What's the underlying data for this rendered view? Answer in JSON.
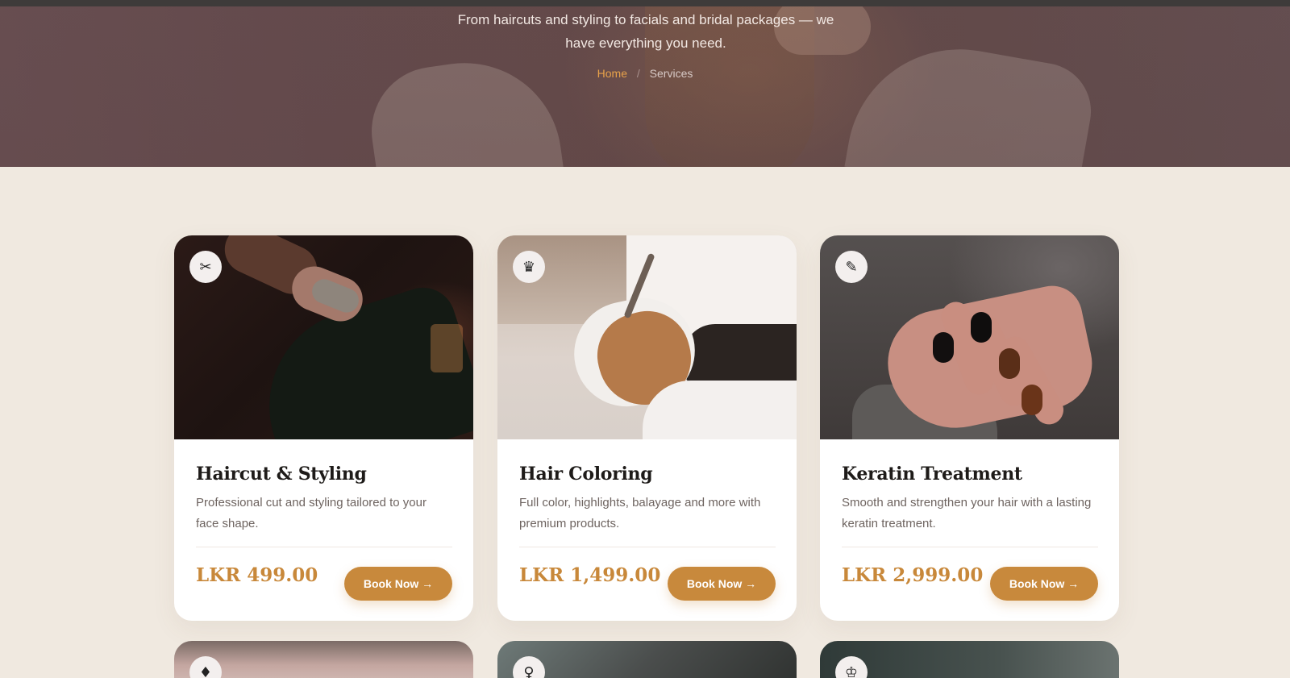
{
  "hero": {
    "subtitle": "From haircuts and styling to facials and bridal packages — we have everything you need.",
    "breadcrumb": {
      "home": "Home",
      "separator": "/",
      "current": "Services"
    }
  },
  "colors": {
    "accent": "#c8893c",
    "background": "#f0e9e0",
    "breadcrumb_active": "#e8a24a"
  },
  "services": [
    {
      "icon": "✂",
      "icon_name": "scissors-icon",
      "title": "Haircut & Styling",
      "description": "Professional cut and styling tailored to your face shape.",
      "price": "LKR 499.00",
      "button": "Book Now →"
    },
    {
      "icon": "♛",
      "icon_name": "woman-hair-icon",
      "title": "Hair Coloring",
      "description": "Full color, highlights, balayage and more with premium products.",
      "price": "LKR 1,499.00",
      "button": "Book Now →"
    },
    {
      "icon": "✎",
      "icon_name": "nail-polish-icon",
      "title": "Keratin Treatment",
      "description": "Smooth and strengthen your hair with a lasting keratin treatment.",
      "price": "LKR 2,999.00",
      "button": "Book Now →"
    }
  ],
  "next_row_icons": [
    {
      "icon": "♦",
      "icon_name": "lipstick-icon"
    },
    {
      "icon": "♀",
      "icon_name": "person-icon"
    },
    {
      "icon": "♔",
      "icon_name": "bride-icon"
    }
  ]
}
